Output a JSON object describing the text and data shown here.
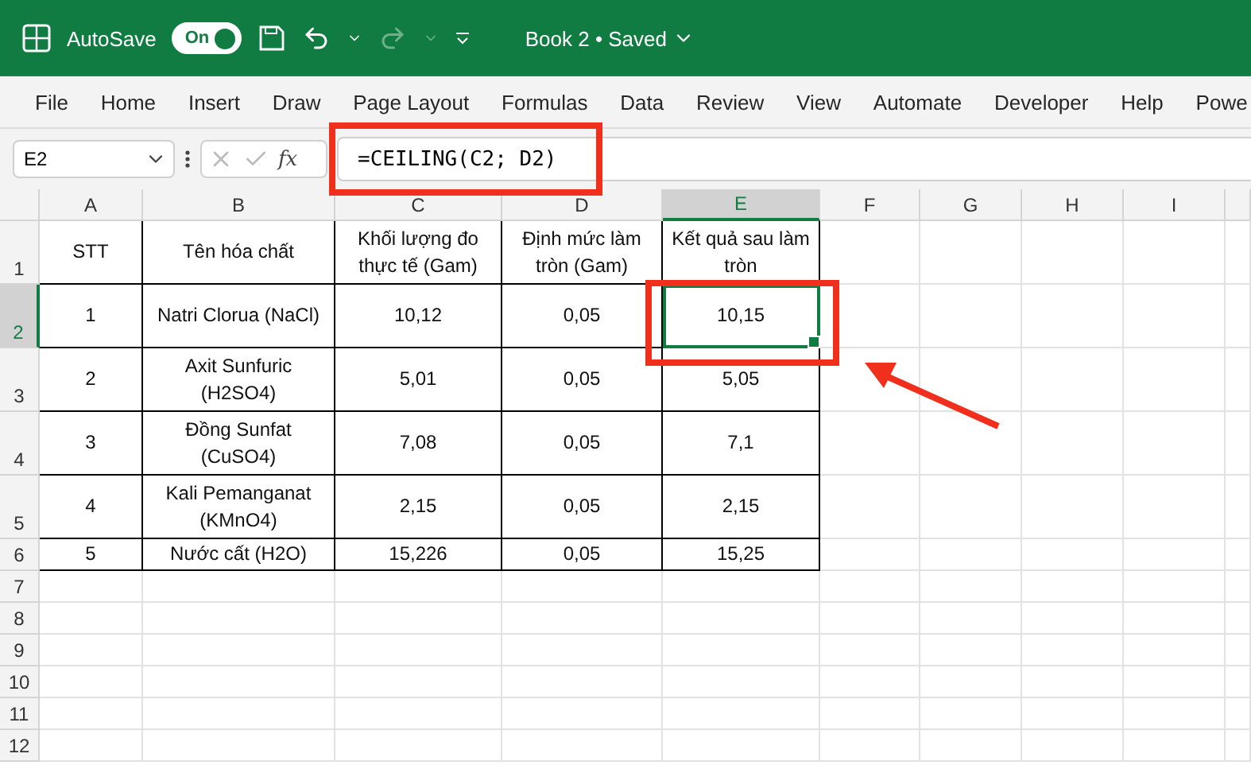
{
  "title_bar": {
    "autosave_label": "AutoSave",
    "autosave_toggle": {
      "label": "On",
      "on": true
    },
    "document_title": "Book 2 • Saved"
  },
  "ribbon_tabs": [
    "File",
    "Home",
    "Insert",
    "Draw",
    "Page Layout",
    "Formulas",
    "Data",
    "Review",
    "View",
    "Automate",
    "Developer",
    "Help",
    "Powe"
  ],
  "formula_bar": {
    "name_box": "E2",
    "fx": "fx",
    "formula": "=CEILING(C2; D2)"
  },
  "sheet": {
    "columns": [
      {
        "label": "A",
        "selected": false
      },
      {
        "label": "B",
        "selected": false
      },
      {
        "label": "C",
        "selected": false
      },
      {
        "label": "D",
        "selected": false
      },
      {
        "label": "E",
        "selected": true
      },
      {
        "label": "F",
        "selected": false
      },
      {
        "label": "G",
        "selected": false
      },
      {
        "label": "H",
        "selected": false
      },
      {
        "label": "I",
        "selected": false
      }
    ],
    "rows": [
      {
        "number": "1",
        "selected": false,
        "tall": true,
        "cells": [
          {
            "text": "STT",
            "selected": false
          },
          {
            "text": "Tên hóa chất",
            "selected": false
          },
          {
            "text": "Khối lượng đo thực tế (Gam)",
            "selected": false
          },
          {
            "text": "Định mức làm tròn (Gam)",
            "selected": false
          },
          {
            "text": "Kết quả sau làm tròn",
            "selected": false
          }
        ]
      },
      {
        "number": "2",
        "selected": true,
        "tall": true,
        "cells": [
          {
            "text": "1",
            "selected": false
          },
          {
            "text": "Natri Clorua (NaCl)",
            "selected": false
          },
          {
            "text": "10,12",
            "selected": false
          },
          {
            "text": "0,05",
            "selected": false
          },
          {
            "text": "10,15",
            "selected": true
          }
        ]
      },
      {
        "number": "3",
        "selected": false,
        "tall": true,
        "cells": [
          {
            "text": "2",
            "selected": false
          },
          {
            "text": "Axit Sunfuric (H2SO4)",
            "selected": false
          },
          {
            "text": "5,01",
            "selected": false
          },
          {
            "text": "0,05",
            "selected": false
          },
          {
            "text": "5,05",
            "selected": false
          }
        ]
      },
      {
        "number": "4",
        "selected": false,
        "tall": true,
        "cells": [
          {
            "text": "3",
            "selected": false
          },
          {
            "text": "Đồng Sunfat (CuSO4)",
            "selected": false
          },
          {
            "text": "7,08",
            "selected": false
          },
          {
            "text": "0,05",
            "selected": false
          },
          {
            "text": "7,1",
            "selected": false
          }
        ]
      },
      {
        "number": "5",
        "selected": false,
        "tall": true,
        "cells": [
          {
            "text": "4",
            "selected": false
          },
          {
            "text": "Kali Pemanganat (KMnO4)",
            "selected": false
          },
          {
            "text": "2,15",
            "selected": false
          },
          {
            "text": "0,05",
            "selected": false
          },
          {
            "text": "2,15",
            "selected": false
          }
        ]
      },
      {
        "number": "6",
        "selected": false,
        "tall": false,
        "cells": [
          {
            "text": "5",
            "selected": false
          },
          {
            "text": "Nước cất (H2O)",
            "selected": false
          },
          {
            "text": "15,226",
            "selected": false
          },
          {
            "text": "0,05",
            "selected": false
          },
          {
            "text": "15,25",
            "selected": false
          }
        ]
      },
      {
        "number": "7",
        "selected": false,
        "tall": false,
        "cells": []
      },
      {
        "number": "8",
        "selected": false,
        "tall": false,
        "cells": []
      },
      {
        "number": "9",
        "selected": false,
        "tall": false,
        "cells": []
      },
      {
        "number": "10",
        "selected": false,
        "tall": false,
        "cells": []
      },
      {
        "number": "11",
        "selected": false,
        "tall": false,
        "cells": []
      },
      {
        "number": "12",
        "selected": false,
        "tall": false,
        "cells": []
      }
    ]
  }
}
